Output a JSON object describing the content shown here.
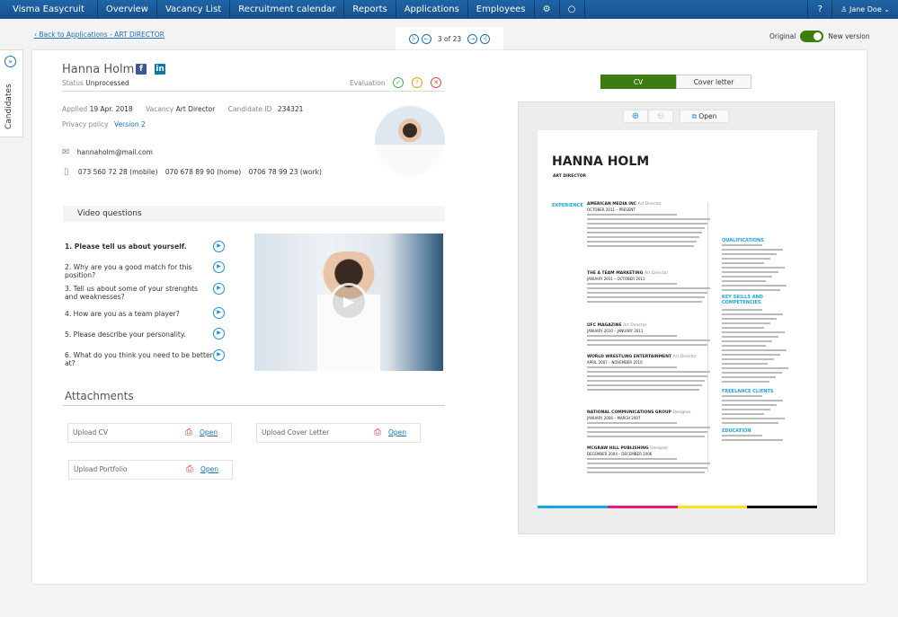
{
  "nav": {
    "brand": "Visma Easycruit",
    "items": [
      "Overview",
      "Vacancy List",
      "Recruitment calendar",
      "Reports",
      "Applications",
      "Employees"
    ],
    "user": "Jane Doe"
  },
  "back_link": "Back to Applications - ART DIRECTOR",
  "pager": {
    "text": "3 of 23"
  },
  "version_toggle": {
    "left": "Original",
    "right": "New version",
    "on": true
  },
  "sidebar": {
    "label": "Candidates"
  },
  "candidate": {
    "name": "Hanna Holm",
    "status_label": "Status",
    "status": "Unprocessed",
    "evaluation_label": "Evaluation",
    "applied_label": "Applied",
    "applied": "19 Apr. 2018",
    "vacancy_label": "Vacancy",
    "vacancy": "Art Director",
    "id_label": "Candidate ID",
    "id": "234321",
    "privacy_label": "Privacy policy",
    "privacy": "Version 2",
    "email": "hannaholm@mail.com",
    "phones": [
      "073 560 72 28 (mobile)",
      "070 678 89 90 (home)",
      "0706 78 99 23 (work)"
    ]
  },
  "video": {
    "title": "Video questions",
    "questions": [
      "1. Please tell us about yourself.",
      "2. Why are you a good match for this position?",
      "3. Tell us about some of your strenghts and weaknesses?",
      "4. How are you as a team player?",
      "5. Please describe your personality.",
      "6. What do you think you need to be better at?"
    ]
  },
  "attachments": {
    "title": "Attachments",
    "items": [
      {
        "label": "Upload CV",
        "action": "Open"
      },
      {
        "label": "Upload Cover Letter",
        "action": "Open"
      },
      {
        "label": "Upload Portfolio",
        "action": "Open"
      }
    ]
  },
  "viewer": {
    "tabs": [
      "CV",
      "Cover letter"
    ],
    "open": "Open"
  },
  "cv": {
    "name": "HANNA HOLM",
    "title": "ART DIRECTOR",
    "experience": "EXPERIENCE",
    "jobs": [
      {
        "company": "AMERICAN MEDIA INC",
        "role": "Art Director",
        "dates": "OCTOBER 2011 – PRESENT"
      },
      {
        "company": "THE A TEAM MARKETING",
        "role": "Art Director",
        "dates": "JANUARY 2011 – OCTOBER 2011"
      },
      {
        "company": "UFC MAGAZINE",
        "role": "Art Director",
        "dates": "JANUARY 2010 – JANUARY 2011"
      },
      {
        "company": "WORLD WRESTLING ENTERTAINMENT",
        "role": "Art Director",
        "dates": "APRIL 2007 – NOVEMBER 2010"
      },
      {
        "company": "NATIONAL COMMUNICATIONS GROUP",
        "role": "Designer",
        "dates": "JANUARY 2006 – MARCH 2007"
      },
      {
        "company": "MCGRAW HILL PUBLISHING",
        "role": "Designer",
        "dates": "DECEMBER 2004 – DECEMBER 2006"
      }
    ],
    "side": [
      "QUALIFICATIONS",
      "KEY SKILLS AND COMPETENCIES",
      "FREELANCE CLIENTS",
      "EDUCATION"
    ]
  }
}
